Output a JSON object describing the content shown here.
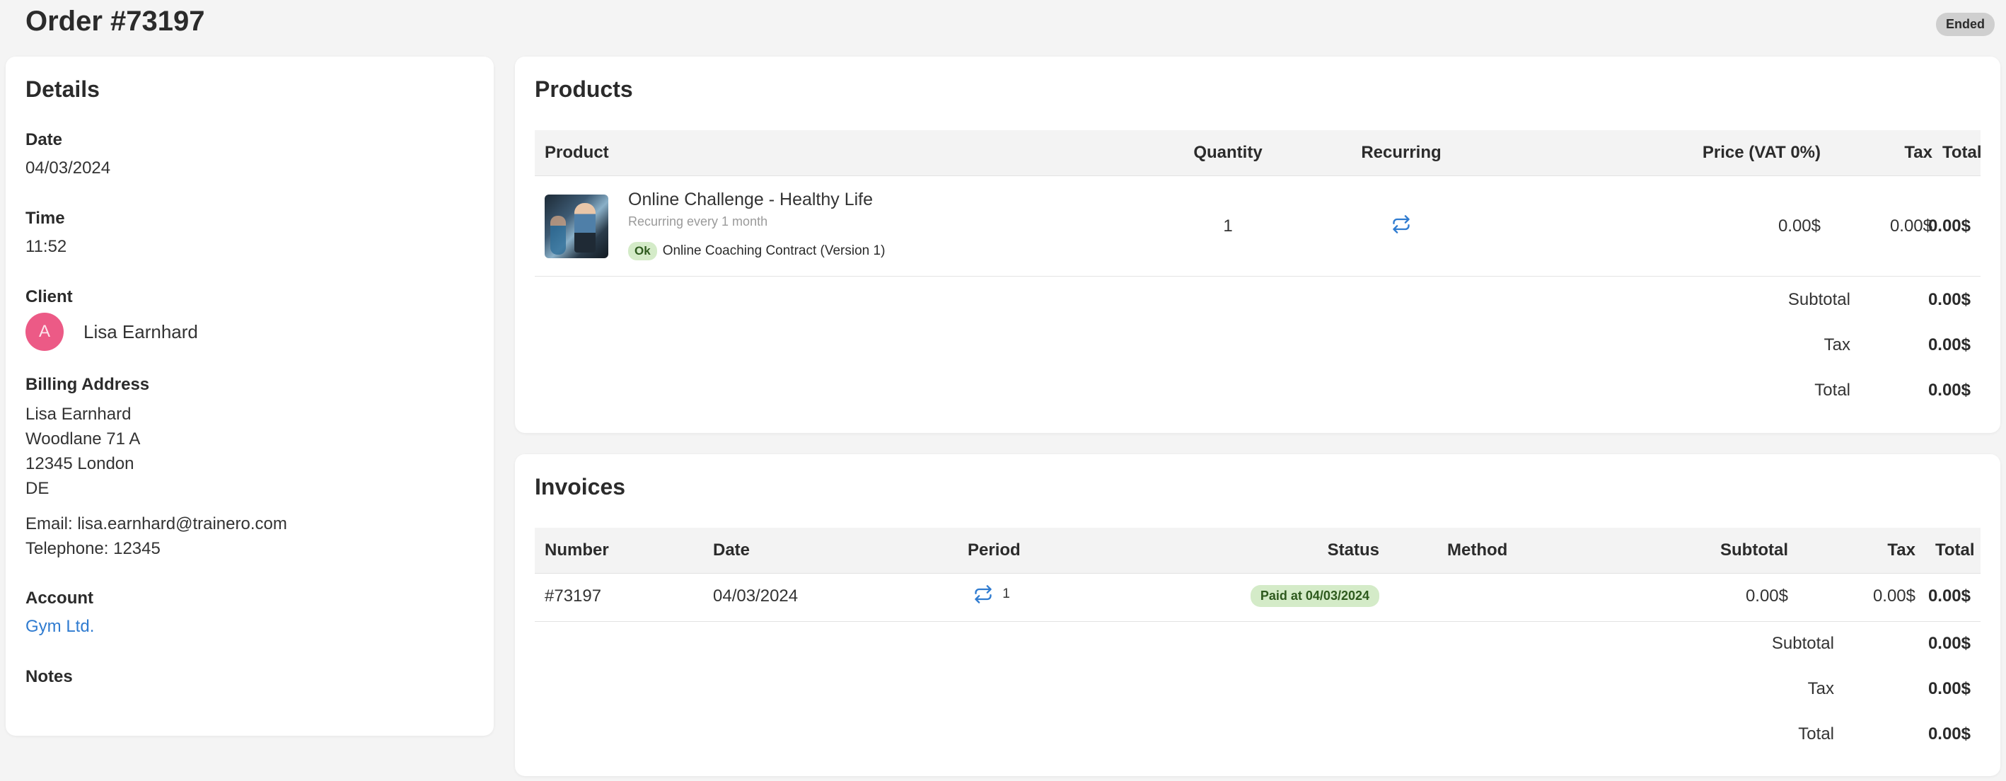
{
  "header": {
    "title": "Order #73197",
    "status": "Ended"
  },
  "details": {
    "title": "Details",
    "date_label": "Date",
    "date": "04/03/2024",
    "time_label": "Time",
    "time": "11:52",
    "client_label": "Client",
    "client_initial": "A",
    "client_name": "Lisa Earnhard",
    "billing_label": "Billing Address",
    "billing_lines": [
      "Lisa Earnhard",
      "Woodlane 71 A",
      "12345 London",
      "DE"
    ],
    "email_line": "Email: lisa.earnhard@trainero.com",
    "phone_line": "Telephone: 12345",
    "account_label": "Account",
    "account": "Gym Ltd.",
    "notes_label": "Notes"
  },
  "products": {
    "title": "Products",
    "columns": {
      "product": "Product",
      "quantity": "Quantity",
      "recurring": "Recurring",
      "price": "Price (VAT 0%)",
      "tax": "Tax",
      "total": "Total"
    },
    "items": [
      {
        "name": "Online Challenge - Healthy Life",
        "subtitle": "Recurring every 1 month",
        "contract_badge": "Ok",
        "contract": "Online Coaching Contract (Version 1)",
        "quantity": "1",
        "price": "0.00$",
        "tax": "0.00$",
        "total": "0.00$"
      }
    ],
    "summary": {
      "subtotal_label": "Subtotal",
      "subtotal": "0.00$",
      "tax_label": "Tax",
      "tax": "0.00$",
      "total_label": "Total",
      "total": "0.00$"
    }
  },
  "invoices": {
    "title": "Invoices",
    "columns": {
      "number": "Number",
      "date": "Date",
      "period": "Period",
      "status": "Status",
      "method": "Method",
      "subtotal": "Subtotal",
      "tax": "Tax",
      "total": "Total"
    },
    "items": [
      {
        "number": "#73197",
        "date": "04/03/2024",
        "period": "1",
        "status": "Paid at 04/03/2024",
        "method": "",
        "subtotal": "0.00$",
        "tax": "0.00$",
        "total": "0.00$"
      }
    ],
    "summary": {
      "subtotal_label": "Subtotal",
      "subtotal": "0.00$",
      "tax_label": "Tax",
      "tax": "0.00$",
      "total_label": "Total",
      "total": "0.00$"
    }
  },
  "colors": {
    "link": "#2f7bd0",
    "avatar": "#ec5a86",
    "success_bg": "#d4ebc8",
    "status_pill": "#cfcfcf"
  },
  "icons": {
    "recurring": "recurring-icon"
  }
}
